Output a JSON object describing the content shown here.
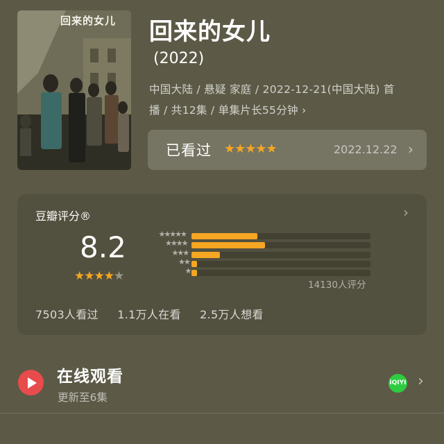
{
  "movie": {
    "poster_title": "回来的女儿",
    "title": "回来的女儿",
    "year": "(2022)",
    "meta_line1": "中国大陆 / 悬疑 家庭 / 2022-12-21(中国大陆) 首",
    "meta_line2": "播 / 共12集 / 单集片长55分钟",
    "meta_chevron": "›"
  },
  "watched": {
    "label": "已看过",
    "stars": "★★★★★",
    "user_rating": 5,
    "date": "2022.12.22",
    "chevron": "›"
  },
  "rating": {
    "title": "豆瓣评分®",
    "chevron": "›",
    "score": "8.2",
    "stars_on": "★★★★",
    "stars_off": "★",
    "distribution": [
      {
        "stars": "★★★★★",
        "fraction": 0.37
      },
      {
        "stars": "★★★★",
        "fraction": 0.41
      },
      {
        "stars": "★★★",
        "fraction": 0.16
      },
      {
        "stars": "★★",
        "fraction": 0.03
      },
      {
        "stars": "★",
        "fraction": 0.03
      }
    ],
    "count": "14130人评分",
    "stats": {
      "watched": "7503人看过",
      "watching": "1.1万人在看",
      "wish": "2.5万人想看"
    }
  },
  "online": {
    "title": "在线观看",
    "subtitle": "更新至6集",
    "provider": "iQIYI",
    "chevron": "›"
  },
  "icons": {
    "play": "play-icon",
    "provider": "iqiyi-icon",
    "chevron": "chevron-right-icon"
  },
  "colors": {
    "background": "#5c5a46",
    "accent_star": "#f5a623",
    "play": "#e84b4b",
    "provider": "#2ecc40"
  }
}
